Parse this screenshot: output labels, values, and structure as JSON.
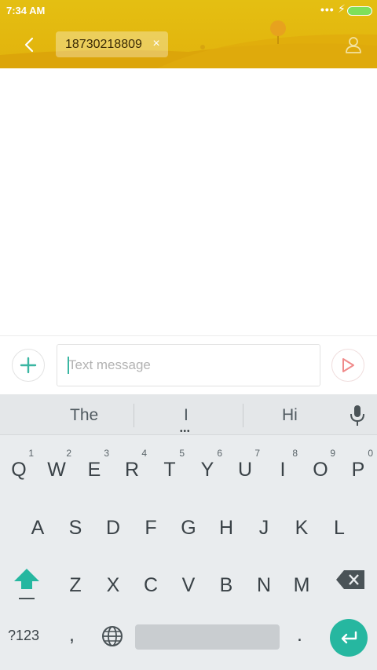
{
  "status_bar": {
    "time": "7:34 AM",
    "more_dots": "•••",
    "charging_icon": "⚡",
    "battery_color": "#7ee05a"
  },
  "header": {
    "background_color": "#e2b60f",
    "back_icon": "chevron-left-icon",
    "recipient_chip": {
      "number": "18730218809",
      "remove_glyph": "×"
    },
    "contact_icon": "person-icon"
  },
  "compose": {
    "attach_icon": "plus-icon",
    "placeholder": "Text message",
    "value": "",
    "send_icon": "send-icon",
    "accent_color": "#3ab6a2"
  },
  "keyboard": {
    "suggestions": [
      "The",
      "I",
      "Hi"
    ],
    "more_suggestions_glyph": "•••",
    "mic_icon": "mic-icon",
    "row1": [
      {
        "label": "Q",
        "hint": "1"
      },
      {
        "label": "W",
        "hint": "2"
      },
      {
        "label": "E",
        "hint": "3"
      },
      {
        "label": "R",
        "hint": "4"
      },
      {
        "label": "T",
        "hint": "5"
      },
      {
        "label": "Y",
        "hint": "6"
      },
      {
        "label": "U",
        "hint": "7"
      },
      {
        "label": "I",
        "hint": "8"
      },
      {
        "label": "O",
        "hint": "9"
      },
      {
        "label": "P",
        "hint": "0"
      }
    ],
    "row2": [
      "A",
      "S",
      "D",
      "F",
      "G",
      "H",
      "J",
      "K",
      "L"
    ],
    "row3": [
      "Z",
      "X",
      "C",
      "V",
      "B",
      "N",
      "M"
    ],
    "shift_icon": "shift-arrow-icon",
    "backspace_icon": "backspace-icon",
    "symbols_label": "?123",
    "comma_label": ",",
    "globe_icon": "globe-icon",
    "period_label": ".",
    "enter_icon": "enter-icon",
    "enter_color": "#26b7a0"
  }
}
